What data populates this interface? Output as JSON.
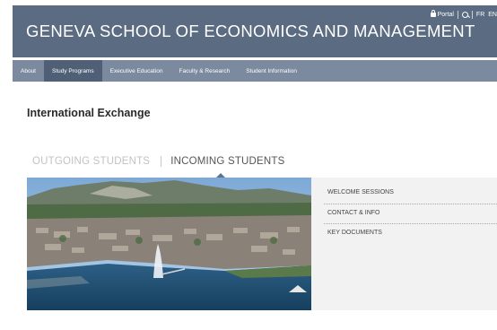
{
  "header": {
    "site_title": "GENEVA SCHOOL OF ECONOMICS AND MANAGEMENT",
    "portal_label": "Portal",
    "lang_fr": "FR",
    "lang_en": "EN",
    "bg_color": "#5a6b82"
  },
  "nav": {
    "items": [
      {
        "label": "About"
      },
      {
        "label": "Study Programs"
      },
      {
        "label": "Executive Education"
      },
      {
        "label": "Faculty & Research"
      },
      {
        "label": "Student Information"
      }
    ],
    "active_index": 1,
    "bg_color": "#7b8a9e",
    "active_color": "#4f5f75"
  },
  "page": {
    "title": "International Exchange"
  },
  "tabs": [
    {
      "label": "OUTGOING STUDENTS",
      "active": false
    },
    {
      "label": "INCOMING STUDENTS",
      "active": true
    }
  ],
  "side_links": [
    {
      "label": "WELCOME SESSIONS"
    },
    {
      "label": "CONTACT & INFO"
    },
    {
      "label": "KEY DOCUMENTS"
    }
  ],
  "icons": {
    "portal": "lock-icon",
    "search": "search-icon",
    "photo": "geneva-lake-photo"
  }
}
